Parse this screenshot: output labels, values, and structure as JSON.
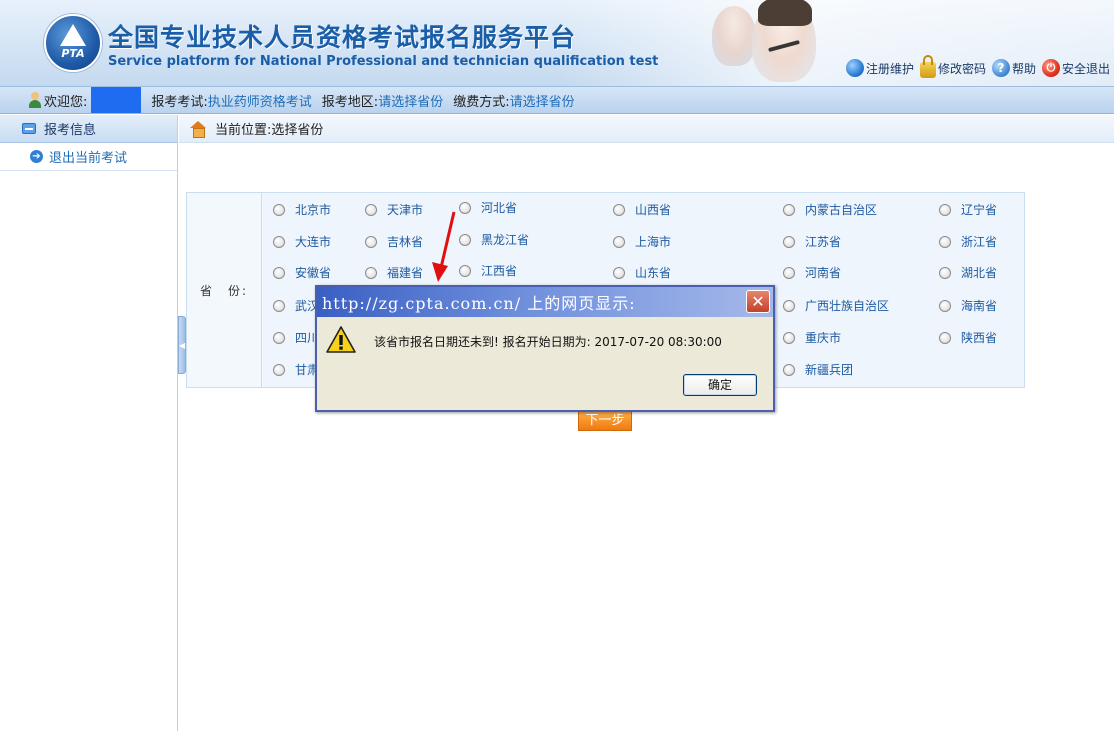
{
  "header": {
    "logo_text": "PTA",
    "title": "全国专业技术人员资格考试报名服务平台",
    "subtitle": "Service platform for National Professional and technician qualification test",
    "links": [
      {
        "label": "注册维护",
        "icon": "globe-icon"
      },
      {
        "label": "修改密码",
        "icon": "lock-icon"
      },
      {
        "label": "帮助",
        "icon": "help-icon"
      },
      {
        "label": "安全退出",
        "icon": "power-icon"
      }
    ]
  },
  "infobar": {
    "welcome_label": "欢迎您:",
    "exam_label": "报考考试:",
    "exam_value": "执业药师资格考试",
    "region_label": "报考地区:",
    "region_value": "请选择省份",
    "payment_label": "缴费方式:",
    "payment_value": "请选择省份"
  },
  "sidebar": {
    "header": "报考信息",
    "items": [
      {
        "label": "退出当前考试"
      }
    ]
  },
  "breadcrumb": {
    "label": "当前位置:",
    "current": "选择省份"
  },
  "province_form": {
    "label": "省　份:",
    "provinces": [
      "北京市",
      "天津市",
      "河北省",
      "山西省",
      "内蒙古自治区",
      "辽宁省",
      "大连市",
      "吉林省",
      "黑龙江省",
      "上海市",
      "江苏省",
      "浙江省",
      "安徽省",
      "福建省",
      "江西省",
      "山东省",
      "河南省",
      "湖北省",
      "武汉",
      "",
      "",
      "",
      "广西壮族自治区",
      "海南省",
      "四川",
      "",
      "",
      "",
      "重庆市",
      "陕西省",
      "甘肃",
      "",
      "",
      "",
      "新疆兵团",
      ""
    ],
    "next_button": "下一步"
  },
  "dialog": {
    "title": "http://zg.cpta.com.cn/ 上的网页显示:",
    "message": "该省市报名日期还未到! 报名开始日期为: 2017-07-20 08:30:00",
    "ok_button": "确定",
    "close_icon": "close-icon",
    "warning_icon": "warning-icon"
  },
  "colors": {
    "link_blue": "#1f6db8",
    "header_blue": "#1b5ea8",
    "next_orange": "#f07a10",
    "dialog_title_blue": "#3a5fc4",
    "annotation_red": "#e01010"
  }
}
